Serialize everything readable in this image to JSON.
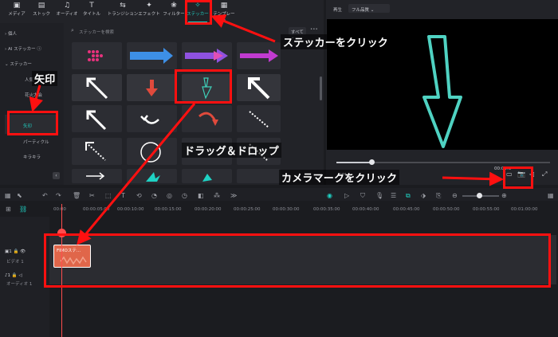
{
  "toolbar": {
    "tabs": [
      {
        "label": "メディア",
        "icon": "media-icon"
      },
      {
        "label": "ストック",
        "icon": "stock-icon"
      },
      {
        "label": "オーディオ",
        "icon": "audio-icon"
      },
      {
        "label": "タイトル",
        "icon": "title-icon"
      },
      {
        "label": "トランジション",
        "icon": "transition-icon"
      },
      {
        "label": "エフェクト",
        "icon": "effect-icon"
      },
      {
        "label": "フィルター",
        "icon": "filter-icon"
      },
      {
        "label": "ステッカー",
        "icon": "sticker-icon"
      },
      {
        "label": "テンプレート",
        "icon": "template-icon"
      }
    ],
    "active_tab": "ステッカー"
  },
  "sidebar": {
    "items": [
      {
        "label": "個人"
      },
      {
        "label": "AI ステッカー"
      },
      {
        "label": "ステッカー"
      },
      {
        "label": "人気"
      },
      {
        "label": "花火大会"
      },
      {
        "label": "矢印"
      },
      {
        "label": "パーティクル"
      },
      {
        "label": "キラキラ"
      }
    ],
    "selected": "矢印"
  },
  "search": {
    "placeholder": "ステッカーを検索",
    "filter_label": "すべて",
    "more_label": "•••"
  },
  "preview": {
    "play_label": "再生",
    "quality_label": "フル品質",
    "time_label": "00:00:0",
    "progress": 0.3
  },
  "timeline": {
    "ruler": [
      "00:00",
      "00:00:05:00",
      "00:00:10:00",
      "00:00:15:00",
      "00:00:20:00",
      "00:00:25:00",
      "00:00:30:00",
      "00:00:35:00",
      "00:00:40:00",
      "00:00:45:00",
      "00:00:50:00",
      "00:00:55:00",
      "00:01:00:00"
    ],
    "tracks": [
      {
        "label": "ビデオ 1",
        "number": "1"
      },
      {
        "label": "オーディオ 1",
        "number": "1"
      }
    ],
    "clip_label": "FIMOステ..."
  },
  "annotations": {
    "sticker_click": "ステッカーをクリック",
    "arrow_label": "矢印",
    "drag_drop": "ドラッグ＆ドロップ",
    "camera_click": "カメラマークをクリック"
  },
  "colors": {
    "accent": "#1fd2c4",
    "highlight": "#ff1010",
    "playhead": "#ff4d4d",
    "clip": "#e0664a",
    "arrow_preview": "#4fd2c2"
  }
}
